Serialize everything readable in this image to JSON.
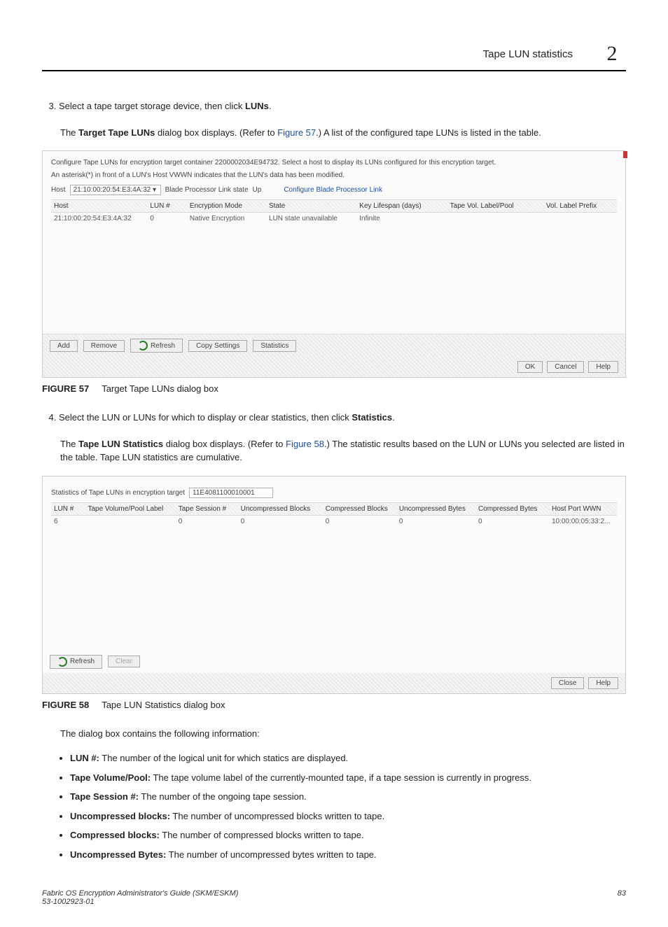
{
  "header": {
    "title": "Tape LUN statistics",
    "chapter": "2"
  },
  "steps": {
    "s3": {
      "num": "3.",
      "text_a": "Select a tape target storage device, then click ",
      "text_b": "LUNs",
      "text_c": ".",
      "para_a": "The ",
      "para_b": "Target Tape LUNs",
      "para_c": " dialog box displays. (Refer to ",
      "para_link": "Figure 57",
      "para_d": ".) A list of the configured tape LUNs is listed in the table."
    },
    "s4": {
      "num": "4.",
      "text_a": "Select the LUN or LUNs for which to display or clear statistics, then click ",
      "text_b": "Statistics",
      "text_c": ".",
      "para_a": "The ",
      "para_b": "Tape LUN Statistics",
      "para_c": " dialog box displays. (Refer to ",
      "para_link": "Figure 58",
      "para_d": ".) The statistic results based on the LUN or LUNs you selected are listed in the table. Tape LUN statistics are cumulative."
    }
  },
  "fig57": {
    "label": "FIGURE 57",
    "title": "Target Tape LUNs dialog box",
    "hint1": "Configure Tape LUNs for encryption target container 2200002034E94732. Select a host to display its LUNs configured for this encryption target.",
    "hint2": "An asterisk(*) in front of a LUN's Host VWWN indicates that the LUN's data has been modified.",
    "host_label": "Host",
    "host_value": "21:10:00:20:54:E3:4A:32",
    "bp_label": "Blade Processor Link state",
    "bp_value": "Up",
    "cfg_link": "Configure Blade Processor Link",
    "cols": {
      "c1": "Host",
      "c2": "LUN #",
      "c3": "Encryption Mode",
      "c4": "State",
      "c5": "Key Lifespan (days)",
      "c6": "Tape Vol. Label/Pool",
      "c7": "Vol. Label Prefix"
    },
    "row": {
      "r1": "21:10:00:20:54:E3:4A:32",
      "r2": "0",
      "r3": "Native Encryption",
      "r4": "LUN state unavailable",
      "r5": "Infinite",
      "r6": "",
      "r7": ""
    },
    "buttons": {
      "add": "Add",
      "remove": "Remove",
      "refresh": "Refresh",
      "copy": "Copy Settings",
      "stats": "Statistics",
      "ok": "OK",
      "cancel": "Cancel",
      "help": "Help"
    }
  },
  "fig58": {
    "label": "FIGURE 58",
    "title": "Tape LUN Statistics dialog box",
    "hint_label": "Statistics of Tape LUNs in encryption target",
    "hint_value": "11E4081100010001",
    "cols": {
      "c1": "LUN #",
      "c2": "Tape Volume/Pool Label",
      "c3": "Tape Session #",
      "c4": "Uncompressed Blocks",
      "c5": "Compressed Blocks",
      "c6": "Uncompressed Bytes",
      "c7": "Compressed Bytes",
      "c8": "Host Port WWN"
    },
    "row": {
      "r1": "6",
      "r2": "",
      "r3": "0",
      "r4": "0",
      "r5": "0",
      "r6": "0",
      "r7": "0",
      "r8": "10:00:00:05:33:2..."
    },
    "buttons": {
      "refresh": "Refresh",
      "clear": "Clear",
      "close": "Close",
      "help": "Help"
    }
  },
  "desc": {
    "intro": "The dialog box contains the following information:",
    "b1_label": "LUN #:",
    "b1_text": " The number of the logical unit for which statics are displayed.",
    "b2_label": "Tape Volume/Pool:",
    "b2_text": " The tape volume label of the currently-mounted tape, if a tape session is currently in progress.",
    "b3_label": "Tape Session #:",
    "b3_text": " The number of the ongoing tape session.",
    "b4_label": "Uncompressed blocks:",
    "b4_text": " The number of uncompressed blocks written to tape.",
    "b5_label": "Compressed blocks:",
    "b5_text": " The number of compressed blocks written to tape.",
    "b6_label": "Uncompressed Bytes:",
    "b6_text": " The number of uncompressed bytes written to tape."
  },
  "footer": {
    "line1": "Fabric OS Encryption Administrator's Guide (SKM/ESKM)",
    "line2": "53-1002923-01",
    "page": "83"
  }
}
